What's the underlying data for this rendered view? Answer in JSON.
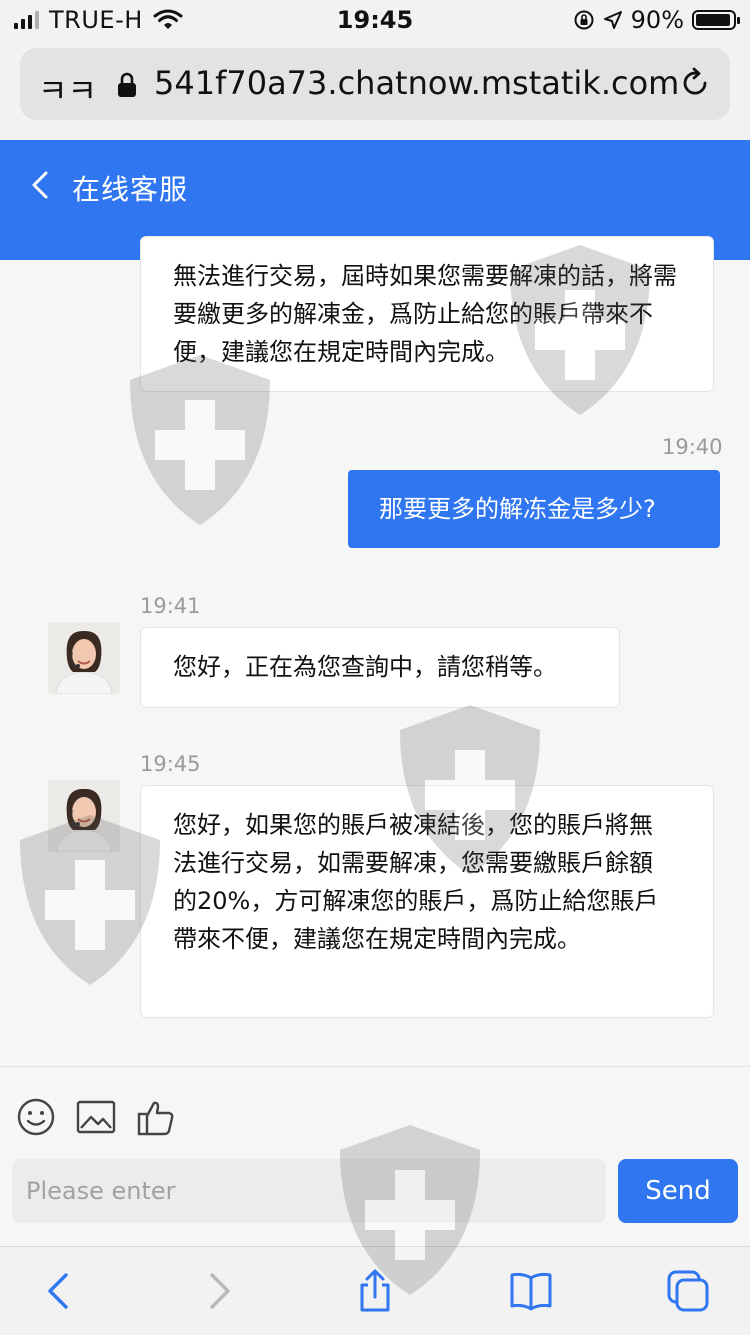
{
  "status_bar": {
    "carrier": "TRUE-H",
    "time": "19:45",
    "battery": "90%"
  },
  "browser": {
    "text_size_label": "ㅋㅋ",
    "url": "541f70a73.chatnow.mstatik.com"
  },
  "chat": {
    "title": "在线客服",
    "messages": [
      {
        "direction": "in",
        "text": "無法進行交易，屆時如果您需要解凍的話，將需要繳更多的解凍金，爲防止給您的賬戶帶來不便，建議您在規定時間內完成。"
      },
      {
        "direction": "out",
        "time": "19:40",
        "text": "那要更多的解冻金是多少?"
      },
      {
        "direction": "in",
        "time": "19:41",
        "text": "您好，正在為您查詢中，請您稍等。"
      },
      {
        "direction": "in",
        "time": "19:45",
        "text": "您好，如果您的賬戶被凍結後，您的賬戶將無法進行交易，如需要解凍，您需要繳賬戶餘額的20%，方可解凍您的賬戶，爲防止給您賬戶帶來不便，建議您在規定時間內完成。"
      }
    ]
  },
  "composer": {
    "placeholder": "Please enter",
    "send_label": "Send",
    "tools": [
      "emoji-icon",
      "image-icon",
      "thumbs-up-icon"
    ]
  },
  "colors": {
    "accent": "#2f76f0",
    "background": "#f6f6f6"
  }
}
